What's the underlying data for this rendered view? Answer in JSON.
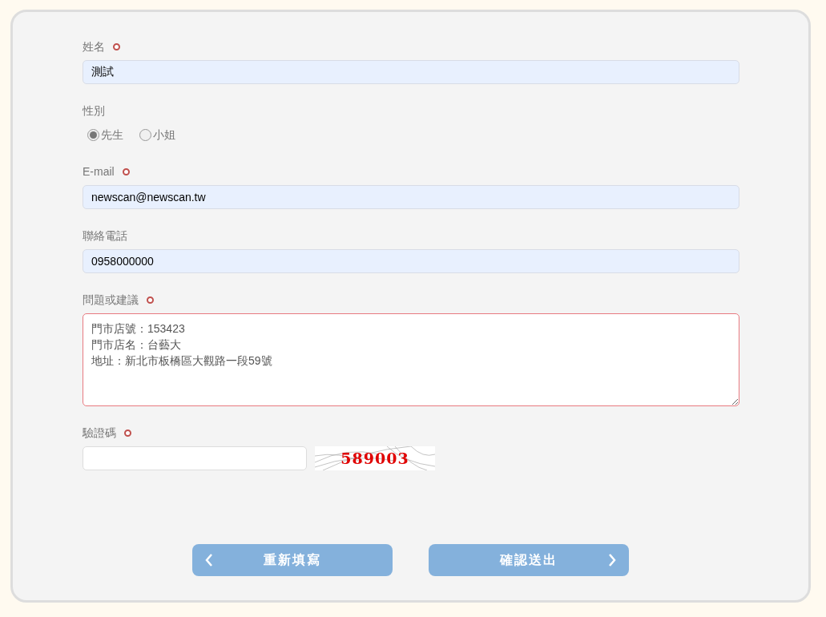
{
  "fields": [
    {
      "kind": "text",
      "label": "姓名",
      "required": true,
      "value": "測試",
      "autofilled": true
    },
    {
      "kind": "radio",
      "label": "性別",
      "required": false,
      "options": [
        {
          "label": "先生",
          "selected": true
        },
        {
          "label": "小姐",
          "selected": false
        }
      ]
    },
    {
      "kind": "text",
      "label": "E-mail",
      "required": true,
      "value": "newscan@newscan.tw",
      "autofilled": true
    },
    {
      "kind": "text",
      "label": "聯絡電話",
      "required": false,
      "value": "0958000000",
      "autofilled": true
    },
    {
      "kind": "textarea",
      "label": "問題或建議",
      "required": true,
      "lines": [
        "門市店號：153423",
        "門市店名：台藝大",
        "地址：新北市板橋區大觀路一段59號"
      ],
      "invalid": true
    },
    {
      "kind": "captcha",
      "label": "驗證碼",
      "required": true,
      "captcha": "589003"
    }
  ],
  "buttons": [
    {
      "label": "重新填寫",
      "kind": "back"
    },
    {
      "label": "確認送出",
      "kind": "next"
    }
  ]
}
